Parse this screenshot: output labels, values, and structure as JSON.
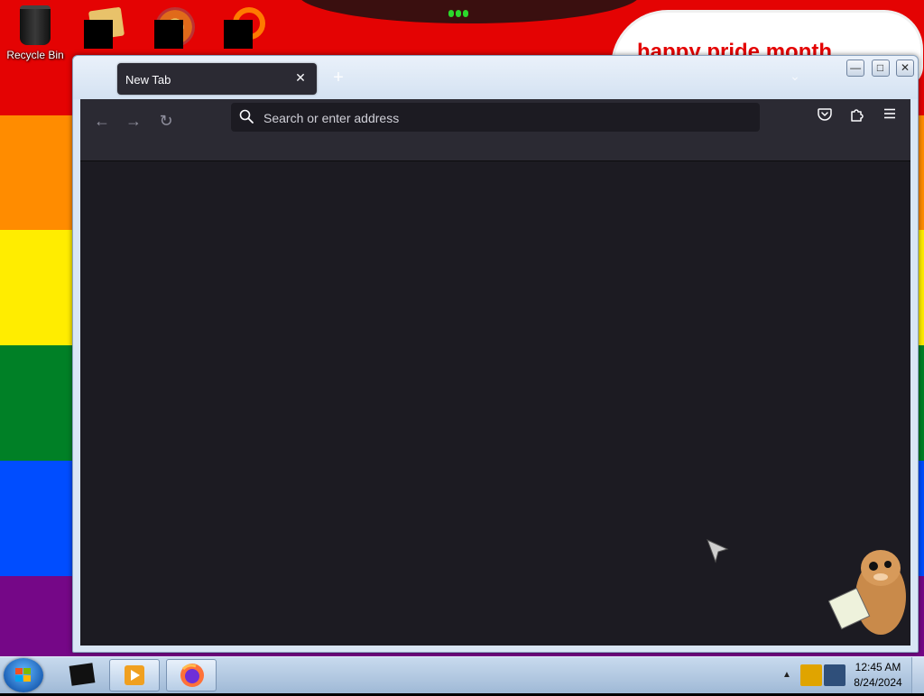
{
  "desktop": {
    "recycle_bin_label": "Recycle Bin",
    "banner_text": "happy pride month"
  },
  "browser": {
    "tab": {
      "title": "New Tab",
      "close_symbol": "✕"
    },
    "new_tab_symbol": "+",
    "window_buttons": {
      "minimize": "—",
      "maximize": "□",
      "close": "✕"
    },
    "nav": {
      "back": "←",
      "forward": "→",
      "reload": "↻"
    },
    "urlbar": {
      "placeholder": "Search or enter address",
      "value": ""
    },
    "toolbar_icons": [
      "pocket-icon",
      "extensions-icon",
      "menu-icon"
    ]
  },
  "taskbar": {
    "clock": {
      "time": "12:45 AM",
      "date": "8/24/2024"
    },
    "tray_arrow": "▲"
  },
  "colors": {
    "toolbar": "#2b2a33",
    "content": "#1c1b22",
    "urlbar": "#1c1b22",
    "text": "#fbfbfe"
  }
}
